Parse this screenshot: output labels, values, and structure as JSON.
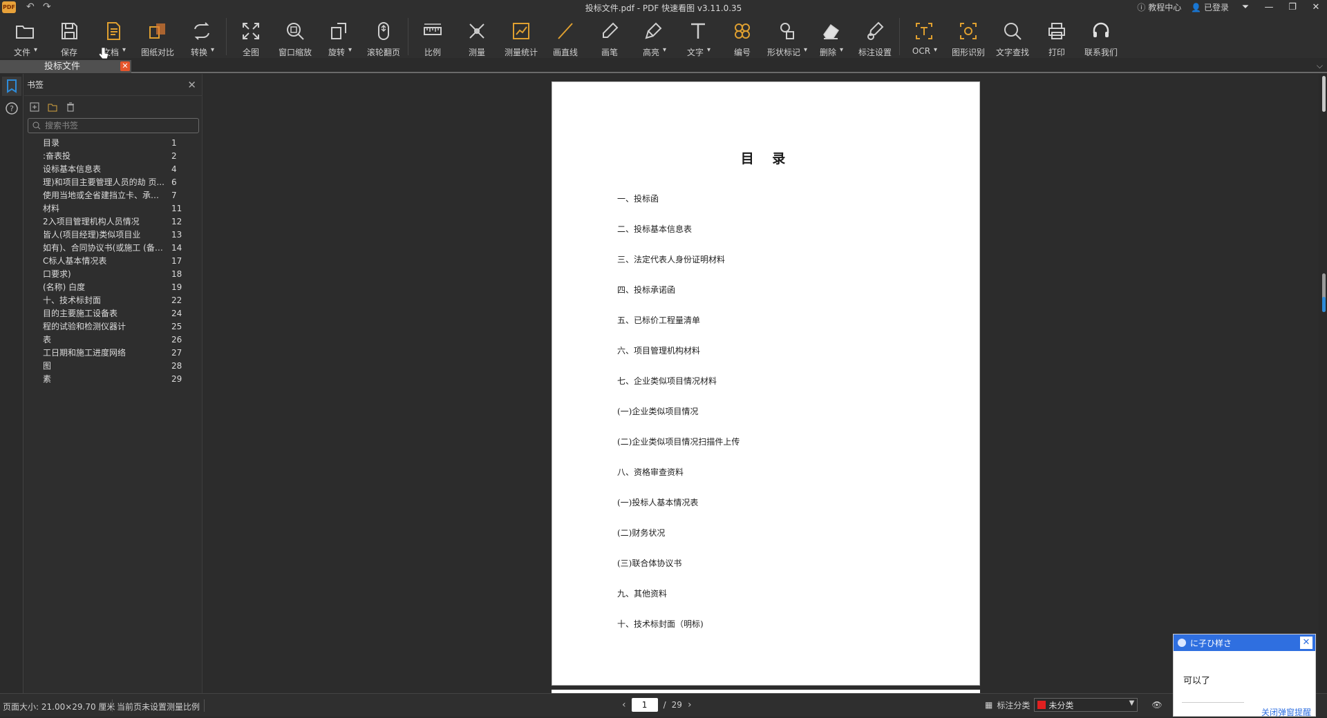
{
  "window": {
    "title": "投标文件.pdf - PDF 快速看图 v3.11.0.35",
    "logo_text": "PDF",
    "tutorial": "教程中心",
    "login": "已登录"
  },
  "toolbar": [
    {
      "id": "file",
      "label": "文件",
      "icon": "folder-icon",
      "dropdown": true
    },
    {
      "id": "save",
      "label": "保存",
      "icon": "save-icon",
      "dropdown": false
    },
    {
      "id": "doc",
      "label": "文档",
      "icon": "document-icon",
      "dropdown": true
    },
    {
      "id": "compare",
      "label": "图纸对比",
      "icon": "compare-icon",
      "dropdown": false
    },
    {
      "id": "convert",
      "label": "转换",
      "icon": "convert-icon",
      "dropdown": true
    },
    {
      "id": "fullview",
      "label": "全图",
      "icon": "fullscreen-icon",
      "dropdown": false
    },
    {
      "id": "winzoom",
      "label": "窗口缩放",
      "icon": "zoom-window-icon",
      "dropdown": false
    },
    {
      "id": "rotate",
      "label": "旋转",
      "icon": "rotate-icon",
      "dropdown": true
    },
    {
      "id": "scroll",
      "label": "滚轮翻页",
      "icon": "mouse-scroll-icon",
      "dropdown": false
    },
    {
      "id": "scale",
      "label": "比例",
      "icon": "ruler-icon",
      "dropdown": false
    },
    {
      "id": "measure",
      "label": "测量",
      "icon": "measure-icon",
      "dropdown": false
    },
    {
      "id": "mstats",
      "label": "测量统计",
      "icon": "measure-stats-icon",
      "dropdown": false
    },
    {
      "id": "line",
      "label": "画直线",
      "icon": "line-icon",
      "dropdown": false
    },
    {
      "id": "pen",
      "label": "画笔",
      "icon": "pen-icon",
      "dropdown": false
    },
    {
      "id": "highlight",
      "label": "高亮",
      "icon": "highlighter-icon",
      "dropdown": true
    },
    {
      "id": "text",
      "label": "文字",
      "icon": "text-icon",
      "dropdown": true
    },
    {
      "id": "number",
      "label": "编号",
      "icon": "numbering-icon",
      "dropdown": false
    },
    {
      "id": "shape",
      "label": "形状标记",
      "icon": "shape-mark-icon",
      "dropdown": true
    },
    {
      "id": "delete",
      "label": "删除",
      "icon": "eraser-icon",
      "dropdown": true
    },
    {
      "id": "markset",
      "label": "标注设置",
      "icon": "mark-settings-icon",
      "dropdown": false
    },
    {
      "id": "ocr",
      "label": "OCR",
      "icon": "ocr-icon",
      "dropdown": true
    },
    {
      "id": "shaperec",
      "label": "图形识别",
      "icon": "shape-recognition-icon",
      "dropdown": false
    },
    {
      "id": "find",
      "label": "文字查找",
      "icon": "search-icon",
      "dropdown": false
    },
    {
      "id": "print",
      "label": "打印",
      "icon": "printer-icon",
      "dropdown": false
    },
    {
      "id": "contact",
      "label": "联系我们",
      "icon": "headset-icon",
      "dropdown": false
    }
  ],
  "tab": {
    "label": "投标文件",
    "close": "✕"
  },
  "panel": {
    "title": "书签",
    "search_placeholder": "搜索书签",
    "bookmarks": [
      {
        "title": "目录",
        "page": "1"
      },
      {
        "title": ":奋表投",
        "page": "2"
      },
      {
        "title": "设标基本信息表",
        "page": "4"
      },
      {
        "title": "理)和项目主要管理人员的劫 页...",
        "page": "6"
      },
      {
        "title": "使用当地或全省建挡立卡、承诺函",
        "page": "7"
      },
      {
        "title": "材料",
        "page": "11"
      },
      {
        "title": "2入项目管理机构人员情况",
        "page": "12"
      },
      {
        "title": "皆人(项目经理)类似项目业",
        "page": "13"
      },
      {
        "title": "如有)、合同协议书(或施工 (备案...",
        "page": "14"
      },
      {
        "title": "C标人基本情况表",
        "page": "17"
      },
      {
        "title": "口要求)",
        "page": "18"
      },
      {
        "title": "(名称) 白度",
        "page": "19"
      },
      {
        "title": "十、技术标封面",
        "page": "22"
      },
      {
        "title": "目的主要施工设备表",
        "page": "24"
      },
      {
        "title": "程的试验和检测仪器计",
        "page": "25"
      },
      {
        "title": "表",
        "page": "26"
      },
      {
        "title": "工日期和施工进度网络",
        "page": "27"
      },
      {
        "title": "图",
        "page": "28"
      },
      {
        "title": "素",
        "page": "29"
      }
    ]
  },
  "document": {
    "heading": "目 录",
    "items": [
      "一、投标函",
      "二、投标基本信息表",
      "三、法定代表人身份证明材料",
      "四、投标承诺函",
      "五、已标价工程量清单",
      "六、项目管理机构材料",
      "七、企业类似项目情况材料",
      "(一)企业类似项目情况",
      "(二)企业类似项目情况扫描件上传",
      "八、资格审查资料",
      "(一)投标人基本情况表",
      "(二)财务状况",
      "(三)联合体协议书",
      "九、其他资料",
      "十、技术标封面（明标)"
    ]
  },
  "status": {
    "page_size": "页面大小: 21.00×29.70 厘米",
    "scale_note": "当前页未设置测量比例",
    "current_page": "1",
    "separator": "/",
    "total_pages": "29",
    "category_label": "标注分类",
    "category_value": "未分类",
    "category_color": "#e02020"
  },
  "notification": {
    "title": "に子ひ样さ",
    "message": "可以了",
    "close_link": "关闭弹窗提醒"
  }
}
